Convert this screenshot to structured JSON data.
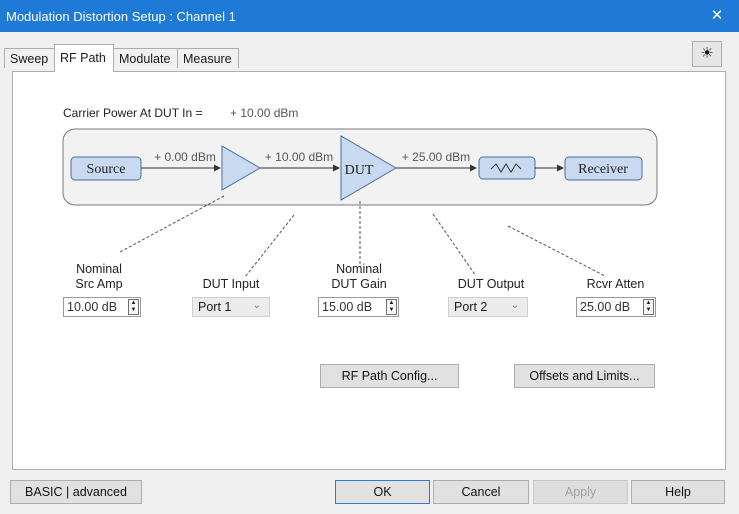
{
  "window": {
    "title": "Modulation Distortion Setup : Channel 1",
    "close_glyph": "✕"
  },
  "tabs": [
    {
      "label": "Sweep",
      "active": false
    },
    {
      "label": "RF Path",
      "active": true
    },
    {
      "label": "Modulate",
      "active": false
    },
    {
      "label": "Measure",
      "active": false
    }
  ],
  "options_icon": "sun-settings-icon",
  "options_glyph": "☀",
  "carrier": {
    "label": "Carrier Power At DUT In =",
    "value": "+ 10.00 dBm"
  },
  "diagram": {
    "source_label": "Source",
    "dut_label": "DUT",
    "receiver_label": "Receiver",
    "level_after_source": "+ 0.00 dBm",
    "level_after_amp": "+ 10.00 dBm",
    "level_after_dut": "+ 25.00 dBm",
    "attenuator_icon": "attenuator-wave-icon"
  },
  "fields": {
    "src_amp": {
      "label_line1": "Nominal",
      "label_line2": "Src Amp",
      "value": "10.00 dB"
    },
    "dut_input": {
      "label": "DUT Input",
      "value": "Port 1"
    },
    "dut_gain": {
      "label_line1": "Nominal",
      "label_line2": "DUT Gain",
      "value": "15.00 dB"
    },
    "dut_output": {
      "label": "DUT Output",
      "value": "Port 2"
    },
    "rcvr_atten": {
      "label": "Rcvr Atten",
      "value": "25.00 dB"
    }
  },
  "panel_buttons": {
    "rf_path_config": "RF Path Config...",
    "offsets_limits": "Offsets and Limits..."
  },
  "footer": {
    "mode": "BASIC | advanced",
    "ok": "OK",
    "cancel": "Cancel",
    "apply": "Apply",
    "help": "Help"
  },
  "colors": {
    "titlebar": "#1e7ad6",
    "block_fill": "#c9daf0",
    "block_stroke": "#4a6ea0",
    "default_button_border": "#2a7bd2"
  }
}
